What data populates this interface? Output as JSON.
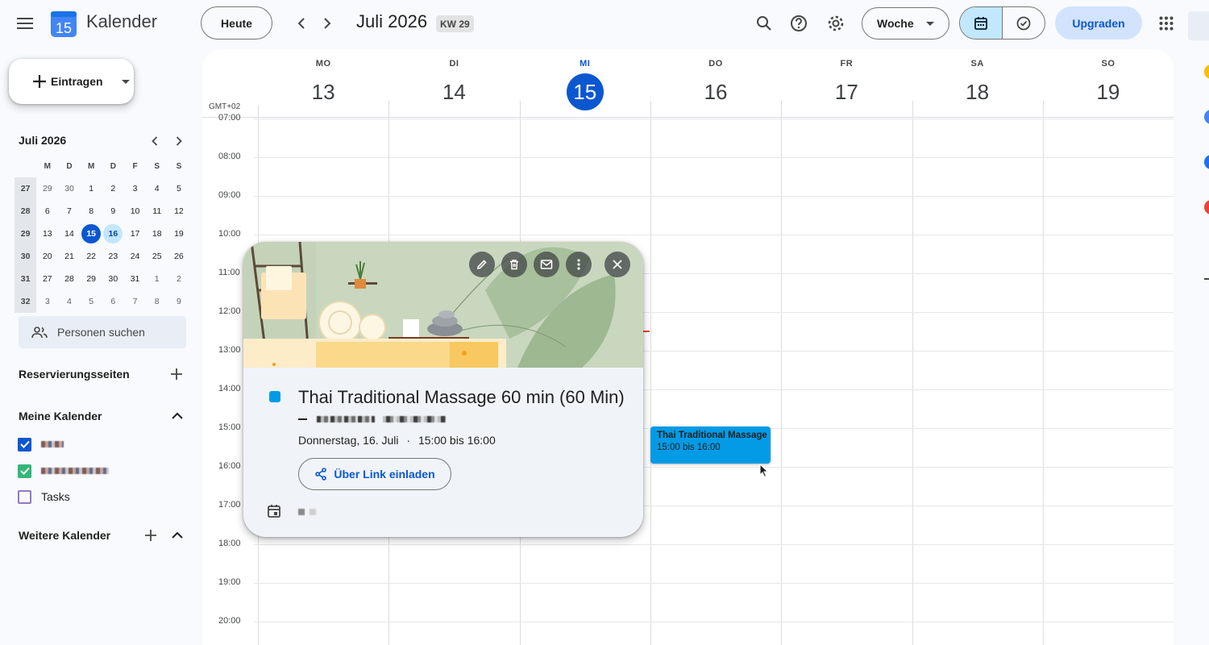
{
  "header": {
    "app_title": "Kalender",
    "app_logo_day": "15",
    "today_label": "Heute",
    "period_title": "Juli 2026",
    "week_badge": "KW 29",
    "view_label": "Woche",
    "upgrade_label": "Upgraden"
  },
  "sidebar": {
    "create_label": "Eintragen",
    "mini_cal": {
      "title": "Juli 2026",
      "weekday_heads": [
        "M",
        "D",
        "M",
        "D",
        "F",
        "S",
        "S"
      ],
      "rows": [
        {
          "week": "27",
          "days": [
            "29",
            "30",
            "1",
            "2",
            "3",
            "4",
            "5"
          ]
        },
        {
          "week": "28",
          "days": [
            "6",
            "7",
            "8",
            "9",
            "10",
            "11",
            "12"
          ]
        },
        {
          "week": "29",
          "days": [
            "13",
            "14",
            "15",
            "16",
            "17",
            "18",
            "19"
          ]
        },
        {
          "week": "30",
          "days": [
            "20",
            "21",
            "22",
            "23",
            "24",
            "25",
            "26"
          ]
        },
        {
          "week": "31",
          "days": [
            "27",
            "28",
            "29",
            "30",
            "31",
            "1",
            "2"
          ]
        },
        {
          "week": "32",
          "days": [
            "3",
            "4",
            "5",
            "6",
            "7",
            "8",
            "9"
          ]
        }
      ],
      "today": "15",
      "selected": "16"
    },
    "people_search_placeholder": "Personen suchen",
    "booking_pages_label": "Reservierungsseiten",
    "my_calendars_label": "Meine Kalender",
    "my_calendars": [
      {
        "name": "",
        "checked": true,
        "color": "#0b57d0"
      },
      {
        "name": "",
        "checked": true,
        "color": "#33b679"
      },
      {
        "name": "Tasks",
        "checked": false,
        "color": "#8e7cc3"
      }
    ],
    "other_calendars_label": "Weitere Kalender"
  },
  "week": {
    "timezone": "GMT+02",
    "days": [
      {
        "dow": "MO",
        "num": "13",
        "today": false
      },
      {
        "dow": "DI",
        "num": "14",
        "today": false
      },
      {
        "dow": "MI",
        "num": "15",
        "today": true
      },
      {
        "dow": "DO",
        "num": "16",
        "today": false
      },
      {
        "dow": "FR",
        "num": "17",
        "today": false
      },
      {
        "dow": "SA",
        "num": "18",
        "today": false
      },
      {
        "dow": "SO",
        "num": "19",
        "today": false
      }
    ],
    "hours": [
      "07:00",
      "08:00",
      "09:00",
      "10:00",
      "11:00",
      "12:00",
      "13:00",
      "14:00",
      "15:00",
      "16:00",
      "17:00",
      "18:00",
      "19:00",
      "20:00"
    ]
  },
  "event_chip": {
    "title": "Thai Traditional Massage",
    "time": "15:00 bis 16:00",
    "color": "#039be5"
  },
  "popup": {
    "title": "Thai Traditional Massage 60 min (60 Min)",
    "date": "Donnerstag, 16. Juli",
    "separator": "·",
    "time": "15:00 bis 16:00",
    "invite_label": "Über Link einladen"
  },
  "colors": {
    "accent": "#0b57d0",
    "event": "#039be5",
    "now_line": "#ea4335"
  }
}
